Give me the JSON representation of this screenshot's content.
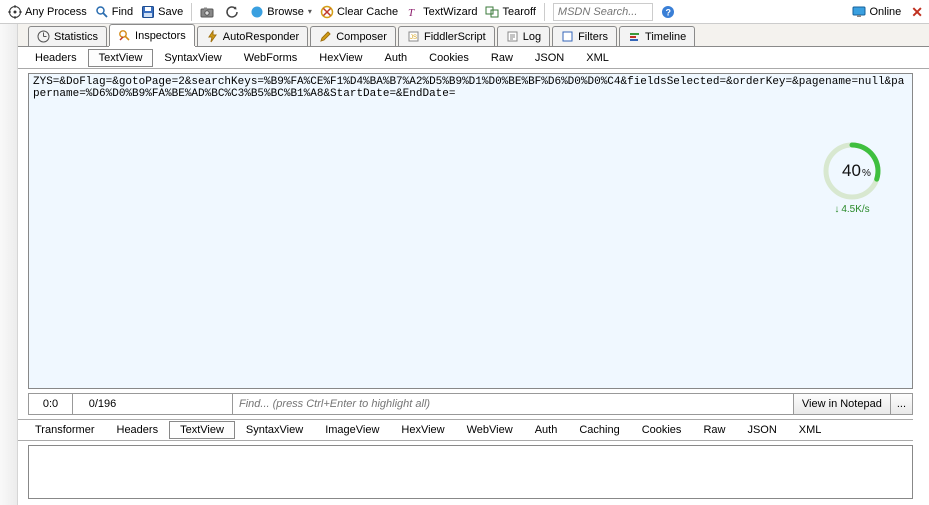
{
  "toolbar": {
    "anyProcess": "Any Process",
    "find": "Find",
    "save": "Save",
    "browse": "Browse",
    "clearCache": "Clear Cache",
    "textWizard": "TextWizard",
    "tearoff": "Tearoff",
    "msdnPlaceholder": "MSDN Search...",
    "online": "Online"
  },
  "tabs": {
    "statistics": "Statistics",
    "inspectors": "Inspectors",
    "autoResponder": "AutoResponder",
    "composer": "Composer",
    "fiddlerScript": "FiddlerScript",
    "log": "Log",
    "filters": "Filters",
    "timeline": "Timeline"
  },
  "reqTabs": {
    "headers": "Headers",
    "textView": "TextView",
    "syntaxView": "SyntaxView",
    "webForms": "WebForms",
    "hexView": "HexView",
    "auth": "Auth",
    "cookies": "Cookies",
    "raw": "Raw",
    "json": "JSON",
    "xml": "XML"
  },
  "requestBody": "ZYS=&DoFlag=&gotoPage=2&searchKeys=%B9%FA%CE%F1%D4%BA%B7%A2%D5%B9%D1%D0%BE%BF%D6%D0%D0%C4&fieldsSelected=&orderKey=&pagename=null&papername=%D6%D0%B9%FA%BE%AD%BC%C3%B5%BC%B1%A8&StartDate=&EndDate=",
  "gauge": {
    "percent": "40",
    "percentSymbol": "%",
    "rate": "4.5K/s"
  },
  "findRow": {
    "pos": "0:0",
    "count": "0/196",
    "placeholder": "Find... (press Ctrl+Enter to highlight all)",
    "viewInNotepad": "View in Notepad",
    "more": "..."
  },
  "respTabs": {
    "transformer": "Transformer",
    "headers": "Headers",
    "textView": "TextView",
    "syntaxView": "SyntaxView",
    "imageView": "ImageView",
    "hexView": "HexView",
    "webView": "WebView",
    "auth": "Auth",
    "caching": "Caching",
    "cookies": "Cookies",
    "raw": "Raw",
    "json": "JSON",
    "xml": "XML"
  },
  "icons": {
    "target": "target-icon",
    "find": "find-icon",
    "save": "save-icon",
    "camera": "camera-icon",
    "refresh": "refresh-icon",
    "browse": "ie-icon",
    "clear": "clear-cache-icon",
    "textWizard": "textwizard-icon",
    "tearoff": "tearoff-icon",
    "help": "help-icon",
    "online": "monitor-icon"
  }
}
